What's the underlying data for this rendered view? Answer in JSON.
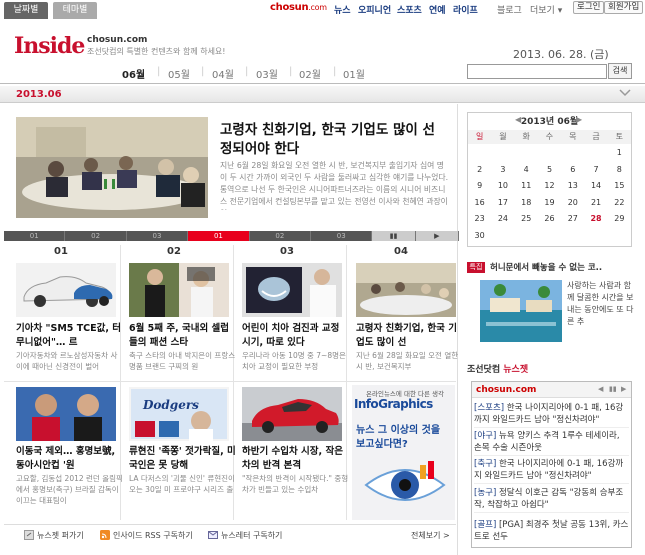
{
  "topnav": {
    "logo": "chosun",
    "logo_suffix": ".com",
    "items": [
      "뉴스",
      "오피니언",
      "스포츠",
      "연예",
      "라이프"
    ],
    "blog": "블로그",
    "more": "더보기",
    "login": "로그인",
    "join": "회원가입"
  },
  "header": {
    "brand": "Inside",
    "site": "chosun.com",
    "tagline": "조선닷컴의 특별한 컨텐츠와 함께 하세요!",
    "date": "2013. 06. 28. (금)"
  },
  "tabs": {
    "date": "날짜별",
    "theme": "테마별"
  },
  "months": [
    "06월",
    "05월",
    "04월",
    "03월",
    "02월",
    "01월"
  ],
  "search": {
    "button": "검색",
    "placeholder": ""
  },
  "month_label": "2013.06",
  "featured": {
    "title": "고령자 친화기업, 한국 기업도 많이 선정되어야 한다",
    "summary": "지난 6월 28일 화요일 오전 열한 시 반, 보건복지부 출입기자 십여 명이 두 시간 가까이 외국인 두 사람을 둘러싸고 심각한 얘기를 나누었다. 통역으로 나선 두 한국인은 시니어파트너즈라는 이름의 시니어 비즈니스 전문기업에서 컨설팅본부를 맡고 있는 전영선 이사와 천혜연 과장이었."
  },
  "slider": [
    "01",
    "02",
    "03",
    "01",
    "02",
    "03",
    "▮▮",
    "▶"
  ],
  "cards": [
    {
      "num": "01",
      "title": "기아차 \"SM5 TCE값, 터무니없어\"… 르",
      "summary": "기아자동차와 르노삼성자동차 사이에 때아닌 신경전이 벌어"
    },
    {
      "num": "02",
      "title": "6월 5째 주, 국내외 셀럽들의 패션 스타",
      "summary": "축구 스타의 아내 박지은이 프랑스 명품 브랜드 구찌의 원"
    },
    {
      "num": "03",
      "title": "어린이 치아 검진과 교정 시기, 따로 있다",
      "summary": "우리나라 아동 10명 중 7~8명은 치아 교정이 필요한 부정"
    },
    {
      "num": "04",
      "title": "고령자 친화기업, 한국 기업도 많이 선",
      "summary": "지난 6월 28일 화요일 오전 열한 시 반, 보건복지부"
    },
    {
      "num": "",
      "title": "이동국 제외… 홍명보號, 동아시안컵 '원",
      "summary": "고요할, 김동섭 2012 런던 올림픽에서 홍명보(축구) 브라질 감독이 이끄는 대표팀이"
    },
    {
      "num": "",
      "title": "류현진 '족쫑' 젓가락질, 미국인은 못 당해",
      "summary": "LA 다저스의 '괴물 신인' 류현진이 오는 30일 미 프로야구 시리즈 출"
    },
    {
      "num": "",
      "title": "하반기 수입차 시장, 작은차의 반격 본격",
      "summary": "\"작은차의 반격이 시작됐다.\" 중형차가 빈들고 있는 수입차"
    }
  ],
  "infographics": {
    "top": "온라인뉴스에 대한 다른 생각",
    "brand": "InfoGraphics",
    "tagline1": "뉴스 그 이상의 것을",
    "tagline2": "보고싶다면?"
  },
  "bottombar": {
    "jet": "뉴스젯 퍼가기",
    "rss": "인사이드 RSS 구독하기",
    "letter": "뉴스레터 구독하기",
    "all": "전체보기 >"
  },
  "calendar": {
    "title": "2013년 06월",
    "weekdays": [
      "일",
      "월",
      "화",
      "수",
      "목",
      "금",
      "토"
    ],
    "days": [
      "",
      "",
      "",
      "",
      "",
      "",
      "1",
      "2",
      "3",
      "4",
      "5",
      "6",
      "7",
      "8",
      "9",
      "10",
      "11",
      "12",
      "13",
      "14",
      "15",
      "16",
      "17",
      "18",
      "19",
      "20",
      "21",
      "22",
      "23",
      "24",
      "25",
      "26",
      "27",
      "28",
      "29",
      "30"
    ],
    "selected": "28"
  },
  "hot": {
    "badge": "특집",
    "title": "허니문에서 빼놓을 수 없는 코..",
    "text": "사랑하는 사람과 함께 달콤한 시간을 보내는 동안에도 또 다른 추"
  },
  "newsjet": {
    "title": "조선닷컴",
    "title_sub": "뉴스젯",
    "logo": "chosun.com",
    "items": [
      {
        "cat": "[스포츠]",
        "text": " 한국 나이지리아에 0-1 패, 16강까지 와일드카드 남아 \"정신차려야\""
      },
      {
        "cat": "[야구]",
        "text": " 뉴욕 양키스 추격 1루수 테세이라, 손목 수술 시즌아웃"
      },
      {
        "cat": "[축구]",
        "text": " 한국 나이지리아에 0-1 패, 16강까지 와일드카드 남아 \"정신차려야\""
      },
      {
        "cat": "[농구]",
        "text": " 정달식 이호근 감독 \"강동희 승부조작, 착잡하고 아쉽다\""
      },
      {
        "cat": "[골프]",
        "text": " [PGA] 최경주 첫날 공동 13위, 카스트로 선두"
      }
    ]
  }
}
